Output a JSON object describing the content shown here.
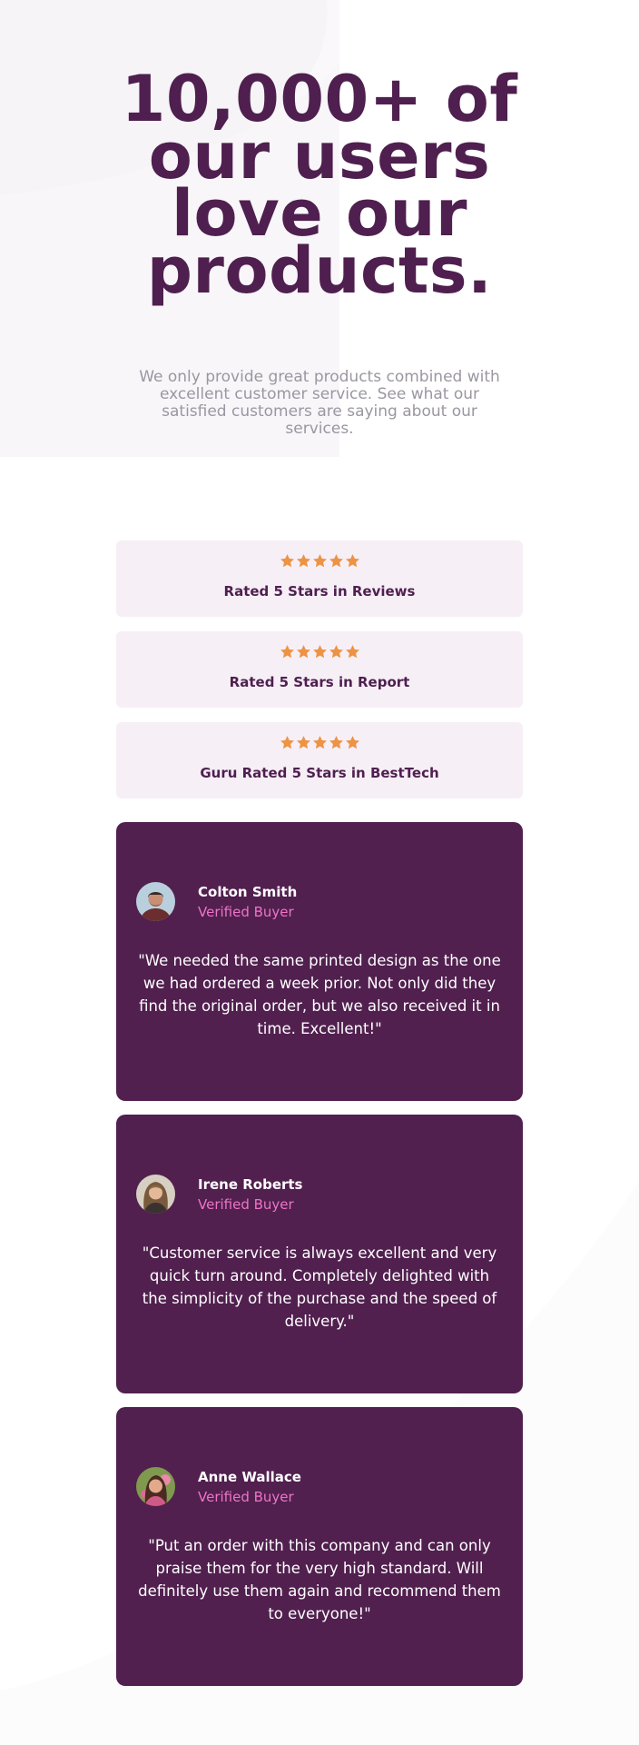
{
  "hero": {
    "title": "10,000+ of our users love our products.",
    "subtitle": "We only provide great products combined with excellent customer service. See what our satisfied customers are saying about our services."
  },
  "ratings": [
    {
      "label": "Rated 5 Stars in Reviews",
      "stars": 5
    },
    {
      "label": "Rated 5 Stars in Report",
      "stars": 5
    },
    {
      "label": "Guru Rated 5 Stars in BestTech",
      "stars": 5
    }
  ],
  "testimonials": [
    {
      "name": "Colton Smith",
      "role": "Verified Buyer",
      "quote": "\"We needed the same printed design as the one we had ordered a week prior. Not only did they find the original order, but we also received it in time. Excellent!\""
    },
    {
      "name": "Irene Roberts",
      "role": "Verified Buyer",
      "quote": "\"Customer service is always excellent and very quick turn around. Completely delighted with the simplicity of the purchase and the speed of delivery.\""
    },
    {
      "name": "Anne Wallace",
      "role": "Verified Buyer",
      "quote": "\"Put an order with this company and can only praise them for the very high standard. Will definitely use them again and recommend them to everyone!\""
    }
  ],
  "colors": {
    "primary": "#4f1f4f",
    "card_background": "#51204f",
    "rating_background": "#f6eff6",
    "star": "#ed9345",
    "accent_pink": "#ee74c7",
    "muted_text": "#9b96a1"
  }
}
